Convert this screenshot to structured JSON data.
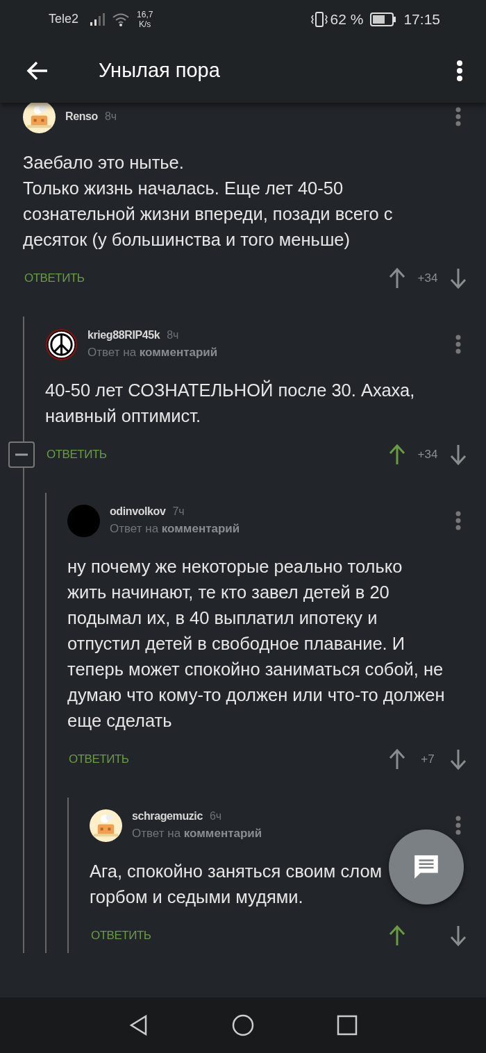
{
  "status_bar": {
    "carrier": "Tele2",
    "speed": "16,7",
    "speed_unit": "K/s",
    "battery": "62 %",
    "time": "17:15"
  },
  "app_bar": {
    "title": "Унылая пора"
  },
  "comments": [
    {
      "avatar": {
        "kind": "house"
      },
      "author": "Renso",
      "time": "8ч",
      "text": "Заебало это нытье.\nТолько жизнь началась. Еще лет 40-50\nсознательной жизни впереди, позади всего с\nдесяток (у большинства и того меньше)",
      "reply_label": "ОТВЕТИТЬ",
      "score": "+34",
      "upvoted": false,
      "children": [
        {
          "avatar": {
            "kind": "peace"
          },
          "author": "krieg88RIP45k",
          "time": "8ч",
          "reply_to": "Ответ на **комментарий**",
          "text": "40-50 лет СОЗНАТЕЛЬНОЙ после 30. Ахаха,\nнаивный оптимист.",
          "reply_label": "ОТВЕТИТЬ",
          "score": "+34",
          "upvoted": true,
          "collapse": {
            "expanded": true
          },
          "children": [
            {
              "avatar": {
                "kind": "dark"
              },
              "author": "odinvolkov",
              "time": "7ч",
              "reply_to": "Ответ на **комментарий**",
              "text": "ну почему же некоторые реально только\nжить начинают, те кто завел детей в 20\nподымал их, в 40 выплатил ипотеку и\nотпустил детей в свободное плавание. И\nтеперь может спокойно заниматься собой, не\nдумаю что кому-то должен или что-то должен\nеще сделать",
              "reply_label": "ОТВЕТИТЬ",
              "score": "+7",
              "upvoted": false,
              "children": [
                {
                  "avatar": {
                    "kind": "house"
                  },
                  "author": "schragemuzic",
                  "time": "6ч",
                  "reply_to": "Ответ на **комментарий**",
                  "text": "Ага, спокойно заняться своим слом\nгорбом и седыми мудями.",
                  "reply_label": "ОТВЕТИТЬ",
                  "upvoted": true
                }
              ]
            }
          ]
        }
      ]
    }
  ]
}
